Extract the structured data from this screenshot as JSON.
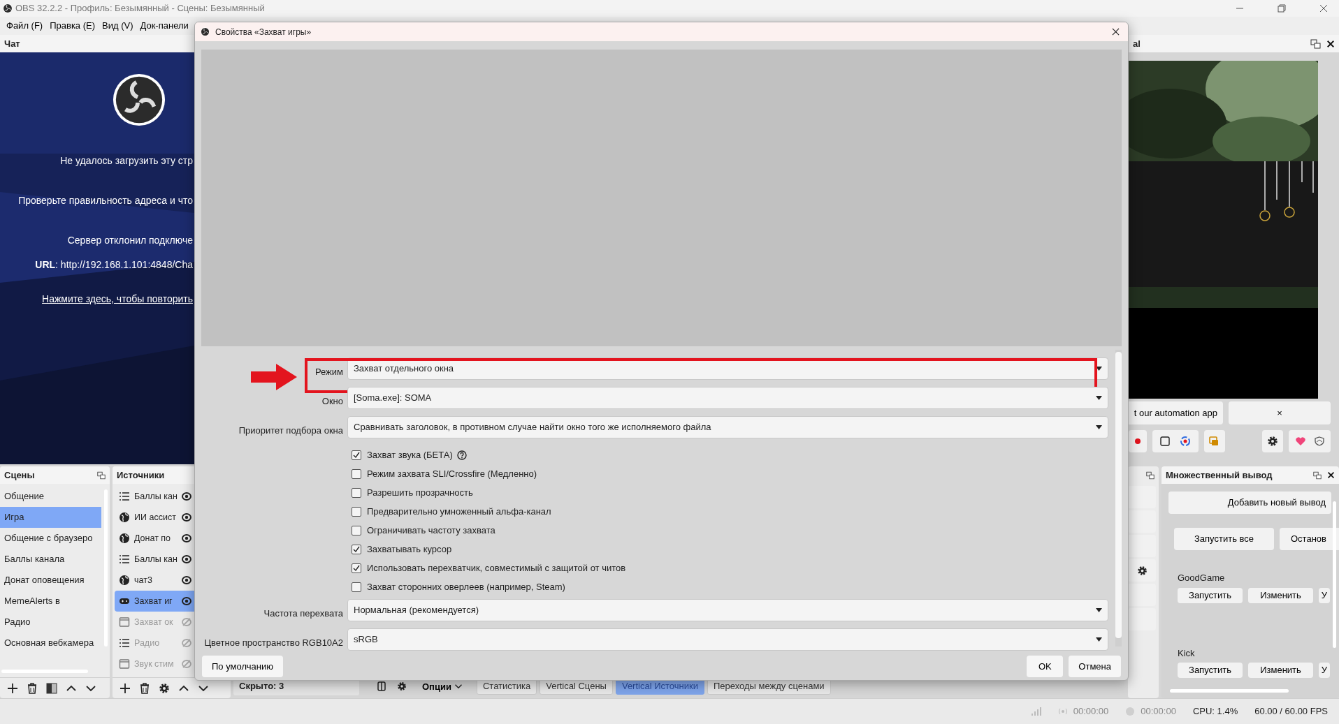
{
  "window": {
    "title": "OBS 32.2.2 - Профиль: Безымянный - Сцены: Безымянный"
  },
  "menu": [
    "Файл (F)",
    "Правка (E)",
    "Вид (V)",
    "Док-панели"
  ],
  "chat_dock": {
    "title": "Чат",
    "lines": [
      "Не удалось загрузить эту стр",
      "Проверьте правильность адреса и что",
      "Сервер отклонил подключе"
    ],
    "url_line": "**URL**: http://192.168.1.101:4848/Cha",
    "retry_link": "Нажмите здесь, чтобы повторить"
  },
  "preview_dock": {
    "title": "al",
    "notice": "t our automation app",
    "notice_close": "×"
  },
  "scenes": {
    "title": "Сцены",
    "items": [
      {
        "label": "Общение",
        "selected": false
      },
      {
        "label": "Игра",
        "selected": true
      },
      {
        "label": "Общение с браузеро",
        "selected": false
      },
      {
        "label": "Баллы канала",
        "selected": false
      },
      {
        "label": "Донат оповещения",
        "selected": false
      },
      {
        "label": "MemeAlerts в",
        "selected": false
      },
      {
        "label": "Радио",
        "selected": false
      },
      {
        "label": "Основная вебкамера",
        "selected": false
      }
    ]
  },
  "sources": {
    "title": "Источники",
    "items": [
      {
        "label": "Баллы кан",
        "kind": "list",
        "visible": true,
        "selected": false
      },
      {
        "label": "ИИ ассист",
        "kind": "browser",
        "visible": true,
        "selected": false
      },
      {
        "label": "Донат по",
        "kind": "browser",
        "visible": true,
        "selected": false
      },
      {
        "label": "Баллы кан",
        "kind": "list",
        "visible": true,
        "selected": false
      },
      {
        "label": "чат3",
        "kind": "browser",
        "visible": true,
        "selected": false
      },
      {
        "label": "Захват иг",
        "kind": "game",
        "visible": true,
        "selected": true
      },
      {
        "label": "Захват ок",
        "kind": "window",
        "visible": false,
        "selected": false
      },
      {
        "label": "Радио",
        "kind": "list",
        "visible": false,
        "selected": false
      },
      {
        "label": "Звук стим",
        "kind": "window",
        "visible": false,
        "selected": false
      }
    ]
  },
  "dock_tabs": {
    "hidden_count": "Скрыто: 3",
    "options": "Опции",
    "tabs": [
      {
        "label": "Статистика",
        "selected": false
      },
      {
        "label": "Vertical Сцены",
        "selected": false
      },
      {
        "label": "Vertical Источники",
        "selected": true
      },
      {
        "label": "Переходы между сценами",
        "selected": false
      }
    ]
  },
  "multi_output": {
    "title": "Множественный вывод",
    "add_button": "Добавить новый вывод",
    "start_all": "Запустить все",
    "stop_all": "Останов",
    "outputs": [
      {
        "name": "GoodGame",
        "buttons": [
          "Запустить",
          "Изменить",
          "У"
        ]
      },
      {
        "name": "Kick",
        "buttons": [
          "Запустить",
          "Изменить",
          "У"
        ]
      }
    ]
  },
  "status_bar": {
    "times": [
      "00:00:00",
      "00:00:00"
    ],
    "cpu": "CPU: 1.4%",
    "fps": "60.00 / 60.00 FPS"
  },
  "dialog": {
    "title": "Свойства «Захват игры»",
    "rows": [
      {
        "kind": "select",
        "label": "Режим",
        "value": "Захват отдельного окна",
        "highlighted": true
      },
      {
        "kind": "select",
        "label": "Окно",
        "value": "[Soma.exe]: SOMA",
        "highlighted": false
      },
      {
        "kind": "select",
        "label": "Приоритет подбора окна",
        "value": "Сравнивать заголовок, в противном случае найти окно того же исполняемого файла",
        "highlighted": false
      },
      {
        "kind": "checkbox",
        "label": "Захват звука (БЕТА)",
        "checked": true,
        "help": true
      },
      {
        "kind": "checkbox",
        "label": "Режим захвата SLI/Crossfire (Медленно)",
        "checked": false,
        "help": false
      },
      {
        "kind": "checkbox",
        "label": "Разрешить прозрачность",
        "checked": false,
        "help": false
      },
      {
        "kind": "checkbox",
        "label": "Предварительно умноженный альфа-канал",
        "checked": false,
        "help": false
      },
      {
        "kind": "checkbox",
        "label": "Ограничивать частоту захвата",
        "checked": false,
        "help": false
      },
      {
        "kind": "checkbox",
        "label": "Захватывать курсор",
        "checked": true,
        "help": false
      },
      {
        "kind": "checkbox",
        "label": "Использовать перехватчик, совместимый с защитой от читов",
        "checked": true,
        "help": false
      },
      {
        "kind": "checkbox",
        "label": "Захват сторонних оверлеев (например, Steam)",
        "checked": false,
        "help": false
      },
      {
        "kind": "select",
        "label": "Частота перехвата",
        "value": "Нормальная (рекомендуется)",
        "highlighted": false
      },
      {
        "kind": "select",
        "label": "Цветное пространство RGB10A2",
        "value": "sRGB",
        "highlighted": false
      }
    ],
    "defaults_button": "По умолчанию",
    "ok_button": "OK",
    "cancel_button": "Отмена"
  }
}
